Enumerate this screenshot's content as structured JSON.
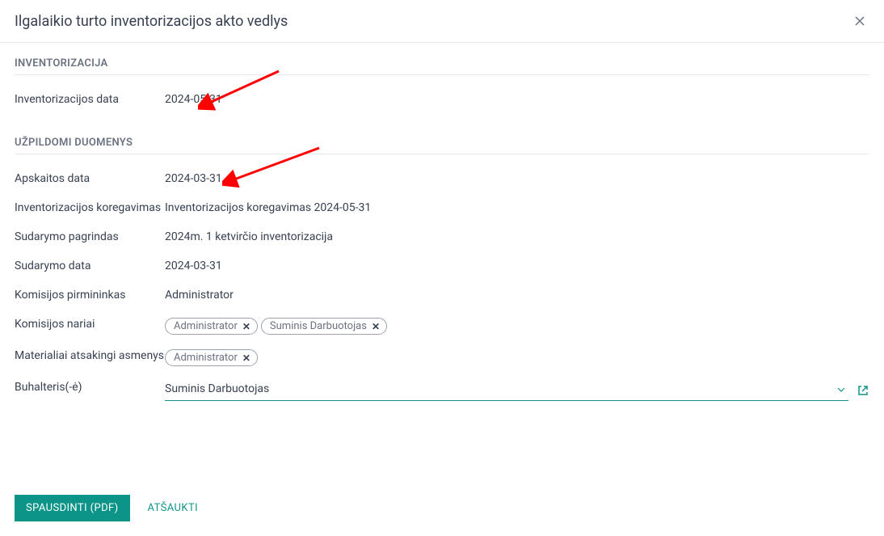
{
  "dialog": {
    "title": "Ilgalaikio turto inventorizacijos akto vedlys"
  },
  "section1": {
    "title": "INVENTORIZACIJA",
    "inventory_date_label": "Inventorizacijos data",
    "inventory_date_value": "2024-05-31"
  },
  "section2": {
    "title": "UŽPILDOMI DUOMENYS",
    "accounting_date_label": "Apskaitos data",
    "accounting_date_value": "2024-03-31",
    "adjustment_label": "Inventorizacijos koregavimas",
    "adjustment_value": "Inventorizacijos koregavimas 2024-05-31",
    "basis_label": "Sudarymo pagrindas",
    "basis_value": "2024m. 1 ketvirčio inventorizacija",
    "creation_date_label": "Sudarymo data",
    "creation_date_value": "2024-03-31",
    "chairman_label": "Komisijos pirmininkas",
    "chairman_value": "Administrator",
    "members_label": "Komisijos nariai",
    "members": [
      {
        "name": "Administrator"
      },
      {
        "name": "Suminis Darbuotojas"
      }
    ],
    "responsible_label": "Materialiai atsakingi asmenys",
    "responsible": [
      {
        "name": "Administrator"
      }
    ],
    "accountant_label": "Buhalteris(-ė)",
    "accountant_value": "Suminis Darbuotojas"
  },
  "footer": {
    "print_label": "SPAUSDINTI (PDF)",
    "cancel_label": "ATŠAUKTI"
  }
}
